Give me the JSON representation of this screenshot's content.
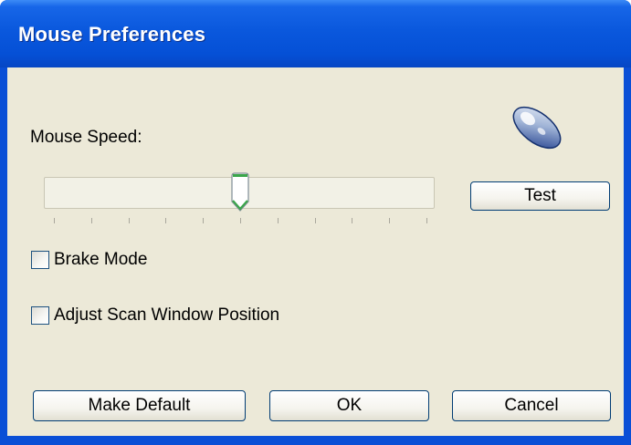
{
  "window": {
    "title": "Mouse Preferences"
  },
  "speed": {
    "label": "Mouse Speed:",
    "level": 0.5,
    "tick_count": 11
  },
  "test_button": {
    "label": "Test"
  },
  "options": {
    "brake_mode": {
      "label": "Brake Mode",
      "checked": false
    },
    "adjust_scan": {
      "label": "Adjust Scan Window Position",
      "checked": false
    }
  },
  "buttons": {
    "make_default": "Make Default",
    "ok": "OK",
    "cancel": "Cancel"
  },
  "icons": {
    "app": "mouse-icon",
    "slider_thumb": "slider-thumb-icon"
  },
  "colors": {
    "titlebar": "#0a58dd",
    "face": "#ece9d8",
    "button_border": "#003c74",
    "thumb_accent": "#3aa64a"
  }
}
